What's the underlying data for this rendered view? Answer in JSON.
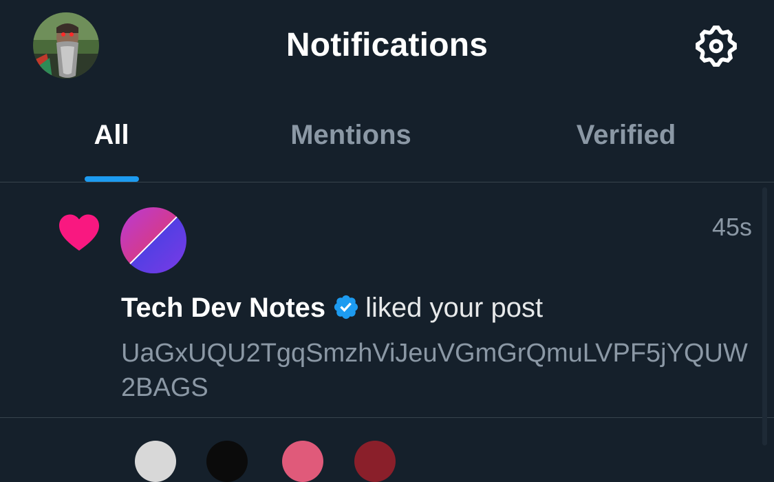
{
  "header": {
    "title": "Notifications",
    "avatar_icon": "user-avatar",
    "settings_icon": "gear-icon"
  },
  "tabs": [
    {
      "label": "All",
      "active": true
    },
    {
      "label": "Mentions",
      "active": false
    },
    {
      "label": "Verified",
      "active": false
    }
  ],
  "notification": {
    "type_icon": "heart-icon",
    "actor_name": "Tech Dev Notes",
    "verified": true,
    "action": "liked your post",
    "time": "45s",
    "post_text": "UaGxUQU2TgqSmzhViJeuVGmGrQmuLVPF5jYQUW2BAGS"
  },
  "colors": {
    "background": "#15202b",
    "accent": "#1d9bf0",
    "like": "#f91880",
    "muted_text": "#8b98a5",
    "divider": "#38444d"
  }
}
